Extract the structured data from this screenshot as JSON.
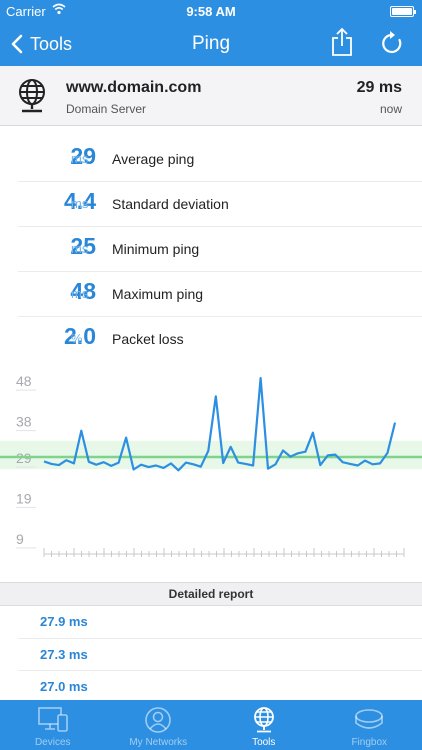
{
  "status_bar": {
    "carrier": "Carrier",
    "time": "9:58 AM"
  },
  "nav": {
    "back_label": "Tools",
    "title": "Ping"
  },
  "host": {
    "name": "www.domain.com",
    "subtitle": "Domain Server",
    "latency": "29 ms",
    "time": "now"
  },
  "stats": [
    {
      "value": "29",
      "unit": "ms",
      "label": "Average ping"
    },
    {
      "value": "4.4",
      "unit": "ms",
      "label": "Standard deviation"
    },
    {
      "value": "25",
      "unit": "ms",
      "label": "Minimum ping"
    },
    {
      "value": "48",
      "unit": "ms",
      "label": "Maximum ping"
    },
    {
      "value": "2.0",
      "unit": "%",
      "label": "Packet loss"
    }
  ],
  "chart_data": {
    "type": "line",
    "yticks": [
      "48",
      "38",
      "29",
      "19",
      "9"
    ],
    "ylim": [
      5,
      52
    ],
    "average": 29,
    "std_band": [
      26,
      33
    ],
    "series": [
      {
        "values": [
          27.9,
          27.3,
          27.0,
          28.2,
          27.4,
          35.5,
          27.8,
          27.1,
          27.7,
          26.8,
          27.6,
          33.8,
          25.9,
          27.1,
          26.5,
          26.9,
          26.3,
          27.4,
          25.7,
          27.6,
          27.2,
          26.6,
          30.5,
          44.0,
          27.5,
          31.5,
          27.6,
          27.3,
          26.9,
          48.5,
          26.1,
          27.2,
          30.6,
          29.1,
          29.9,
          30.3,
          35.0,
          27.0,
          29.4,
          29.6,
          27.7,
          27.3,
          26.9,
          28.1,
          27.2,
          27.4,
          30.0,
          37.5
        ]
      }
    ]
  },
  "report": {
    "header": "Detailed report",
    "rows": [
      "27.9 ms",
      "27.3 ms",
      "27.0 ms"
    ]
  },
  "tabs": [
    {
      "label": "Devices",
      "icon": "devices-icon",
      "active": false
    },
    {
      "label": "My Networks",
      "icon": "user-icon",
      "active": false
    },
    {
      "label": "Tools",
      "icon": "globe-icon",
      "active": true
    },
    {
      "label": "Fingbox",
      "icon": "fingbox-icon",
      "active": false
    }
  ],
  "colors": {
    "brand": "#2d8fe1",
    "value": "#2a86d6",
    "line": "#2d8fe1",
    "average": "#7fd38a",
    "band": "#e7f8e9"
  }
}
